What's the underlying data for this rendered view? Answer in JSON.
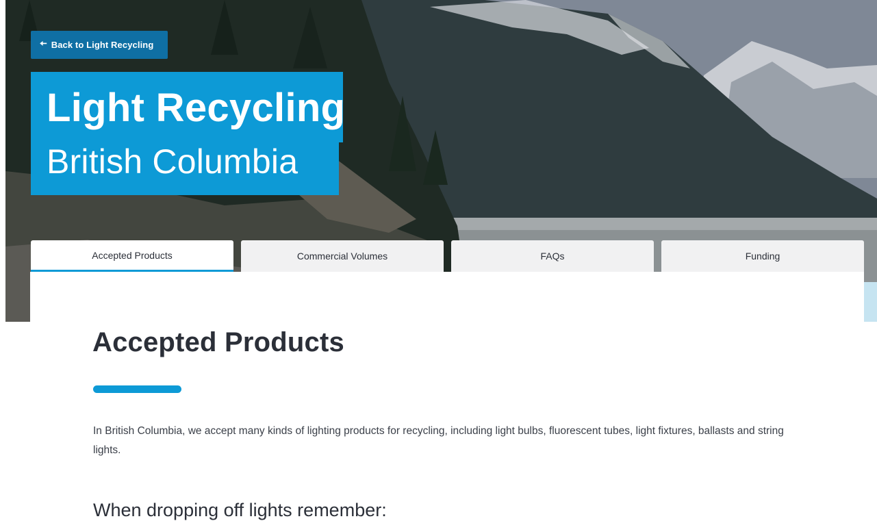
{
  "hero": {
    "back_label": "Back to Light Recycling",
    "title_line1": "Light Recycling",
    "title_line2": "British Columbia",
    "image": "mountain-lake-forest-photo"
  },
  "tabs": [
    {
      "label": "Accepted Products",
      "active": true
    },
    {
      "label": "Commercial Volumes",
      "active": false
    },
    {
      "label": "FAQs",
      "active": false
    },
    {
      "label": "Funding",
      "active": false
    }
  ],
  "main": {
    "heading": "Accepted Products",
    "intro": "In British Columbia, we accept many kinds of lighting products for recycling, including light bulbs, fluorescent tubes, light fixtures, ballasts and string lights.",
    "subheading": "When dropping off lights remember:"
  },
  "colors": {
    "accent": "#0d9ad6",
    "back_button": "#0f6fa4",
    "text_dark": "#2b2f38"
  }
}
